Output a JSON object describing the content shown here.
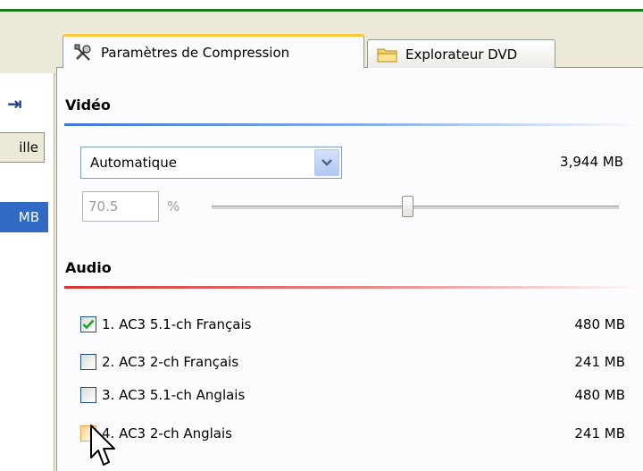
{
  "left_panel": {
    "header_fragment": "ille",
    "selected_fragment": "MB"
  },
  "tabs": [
    {
      "label": "Paramètres de Compression",
      "icon": "gear-tools-icon",
      "active": true
    },
    {
      "label": "Explorateur DVD",
      "icon": "folder-icon",
      "active": false
    }
  ],
  "video": {
    "title": "Vidéo",
    "mode_select_value": "Automatique",
    "size": "3,944 MB",
    "percent_value": "70.5",
    "percent_symbol": "%",
    "slider_level_percent": 48
  },
  "audio": {
    "title": "Audio",
    "tracks": [
      {
        "label": "1. AC3 5.1-ch Français",
        "size": "480 MB",
        "checked": true
      },
      {
        "label": "2. AC3 2-ch Français",
        "size": "241 MB",
        "checked": false
      },
      {
        "label": "3. AC3 5.1-ch Anglais",
        "size": "480 MB",
        "checked": false
      },
      {
        "label": "4. AC3 2-ch Anglais",
        "size": "241 MB",
        "checked": false
      }
    ]
  },
  "colors": {
    "accent_green": "#1c7a1c",
    "video_rule": "#3c78d8",
    "audio_rule": "#d83232",
    "tab_highlight": "#ffc83c"
  }
}
